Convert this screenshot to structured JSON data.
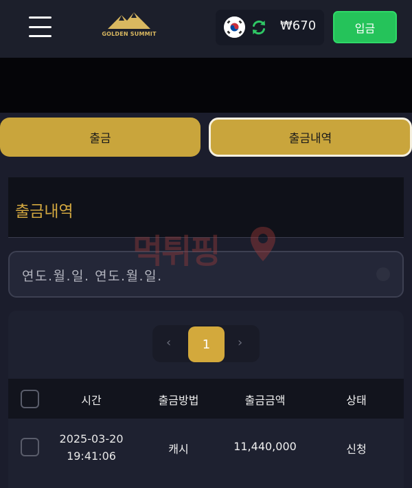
{
  "header": {
    "menu_icon": "hamburger-icon",
    "logo_text": "GOLDEN SUMMIT",
    "flag_icon": "korea-flag-icon",
    "refresh_icon": "refresh-icon",
    "balance": "₩670",
    "deposit_label": "입금"
  },
  "tabs": [
    {
      "label": "출금",
      "active": false
    },
    {
      "label": "출금내역",
      "active": true
    }
  ],
  "section": {
    "title": "출금내역"
  },
  "date_filter": {
    "value": "연도.월.일.  연도.월.일."
  },
  "pagination": {
    "prev": "‹",
    "current": "1",
    "next": "›"
  },
  "table": {
    "columns": [
      "시간",
      "출금방법",
      "출금금액",
      "상태"
    ],
    "rows": [
      {
        "date": "2025-03-20",
        "time": "19:41:06",
        "method": "캐시",
        "amount": "11,440,000",
        "status": "신청"
      }
    ]
  },
  "watermark": {
    "text": "먹튀핑"
  },
  "colors": {
    "accent_gold": "#c9a53c",
    "deposit_green": "#25c35a",
    "title_gold": "#d3a840"
  }
}
